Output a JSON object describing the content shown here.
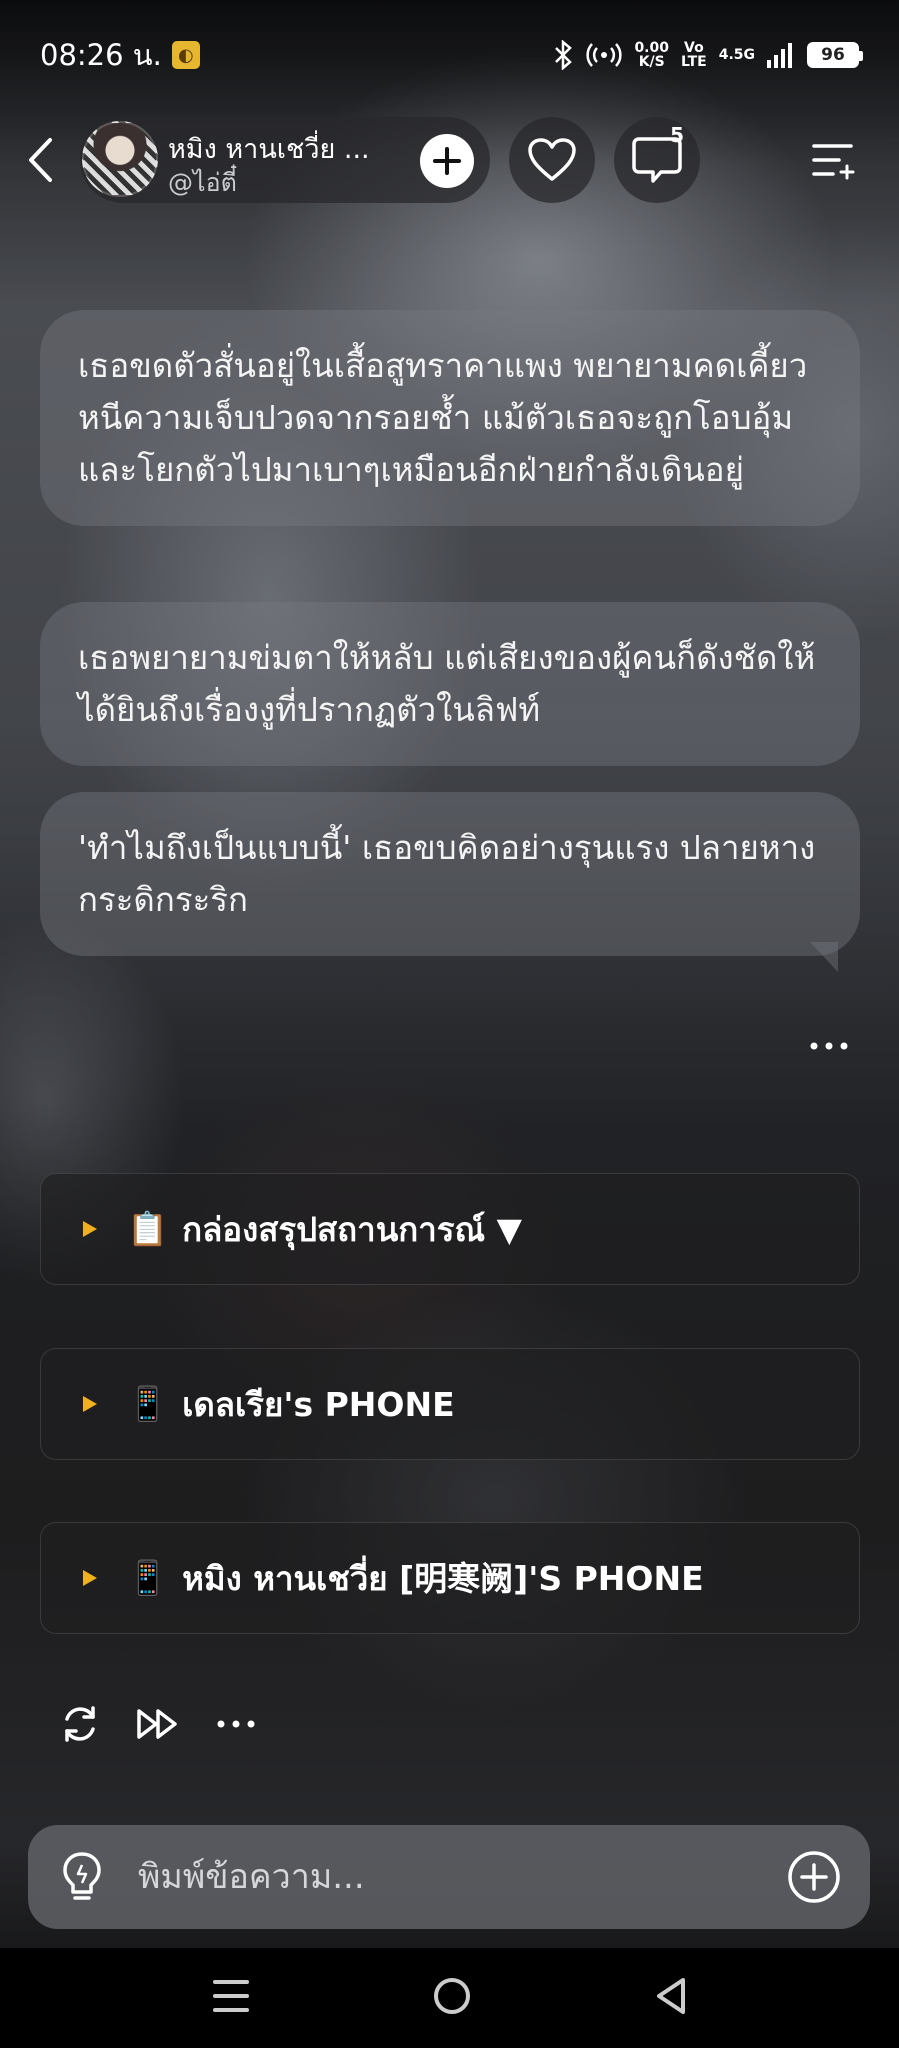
{
  "status_bar": {
    "time": "08:26 น.",
    "net_speed_top": "0.00",
    "net_speed_unit": "K/S",
    "volte_top": "Vo",
    "volte_bottom": "LTE",
    "network": "4.5G",
    "battery": "96"
  },
  "header": {
    "character_name": "หมิง หานเชวี่ย ...",
    "creator_handle": "@ไอ่ตี๋",
    "comment_count": "5"
  },
  "messages": [
    "เธอขดตัวสั่นอยู่ในเสื้อสูทราคาแพง พยายามคดเคี้ยวหนีความเจ็บปวดจากรอยช้ำ แม้ตัวเธอจะถูกโอบอุ้มและโยกตัวไปมาเบาๆเหมือนอีกฝ่ายกำลังเดินอยู่",
    "เธอพยายามข่มตาให้หลับ แต่เสียงของผู้คนก็ดังชัดให้ได้ยินถึงเรื่องงูที่ปรากฏตัวในลิฟท์",
    "'ทำไมถึงเป็นแบบนี้' เธอขบคิดอย่างรุนแรง ปลายหางกระดิกระริก"
  ],
  "collapsibles": [
    {
      "emoji": "📋",
      "label": "กล่องสรุปสถานการณ์ ▼"
    },
    {
      "emoji": "📱",
      "label": "เดลเรีย's PHONE"
    },
    {
      "emoji": "📱",
      "label": "หมิง หานเชวี่ย [明寒阙]'S PHONE"
    }
  ],
  "input": {
    "placeholder": "พิมพ์ข้อความ..."
  },
  "icons": {
    "back": "chevron-left-icon",
    "follow": "plus-icon",
    "like": "heart-icon",
    "comments": "comment-icon",
    "menu": "playlist-icon",
    "regenerate": "refresh-icon",
    "continue": "fast-forward-icon",
    "more": "more-horizontal-icon",
    "hint": "lightbulb-icon",
    "add": "plus-circle-icon"
  },
  "colors": {
    "accent_triangle": "#f0b020",
    "bubble_bg": "rgba(120,122,128,0.42)"
  }
}
